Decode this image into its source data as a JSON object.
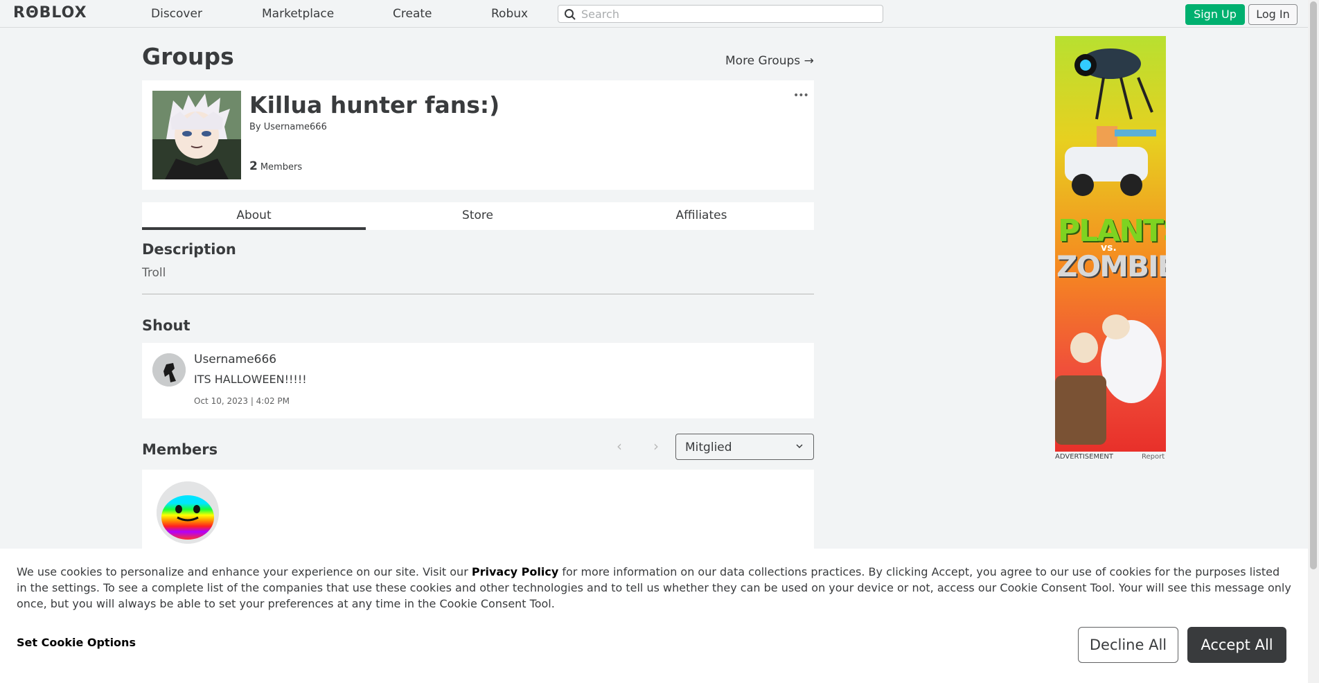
{
  "nav": {
    "logo": "RΘBLOX",
    "links": [
      "Discover",
      "Marketplace",
      "Create",
      "Robux"
    ],
    "search_placeholder": "Search",
    "signup": "Sign Up",
    "login": "Log In"
  },
  "page": {
    "title": "Groups",
    "more_groups": "More Groups →"
  },
  "group": {
    "name": "Killua hunter fans:)",
    "owner_prefix": "By",
    "owner": "Username666",
    "member_count": "2",
    "member_label": "Members",
    "more_menu": "•••"
  },
  "tabs": [
    "About",
    "Store",
    "Affiliates"
  ],
  "about": {
    "description_heading": "Description",
    "description": "Troll",
    "shout_heading": "Shout",
    "shout": {
      "user": "Username666",
      "message": "ITS HALLOWEEN!!!!!",
      "date": "Oct 10, 2023 | 4:02 PM"
    },
    "members_heading": "Members",
    "role_selected": "Mitglied"
  },
  "ad": {
    "title_line1": "PLANTS",
    "title_vs": "vs.",
    "title_line2": "ZOMBIES",
    "label": "ADVERTISEMENT",
    "report": "Report"
  },
  "cookie": {
    "text_before": "We use cookies to personalize and enhance your experience on our site. Visit our ",
    "link": "Privacy Policy",
    "text_after": " for more information on our data collections practices. By clicking Accept, you agree to our use of cookies for the purposes listed in the settings. To see a complete list of the companies that use these cookies and other technologies and to tell us whether they can be used on your device or not, access our Cookie Consent Tool. Your will see this message only once, but you will always be able to set your preferences at any time in the Cookie Consent Tool.",
    "settings": "Set Cookie Options",
    "decline": "Decline All",
    "accept": "Accept All"
  },
  "colors": {
    "accent_green": "#00b06f",
    "page_bg": "#f2f4f5",
    "dark": "#393b3d"
  }
}
